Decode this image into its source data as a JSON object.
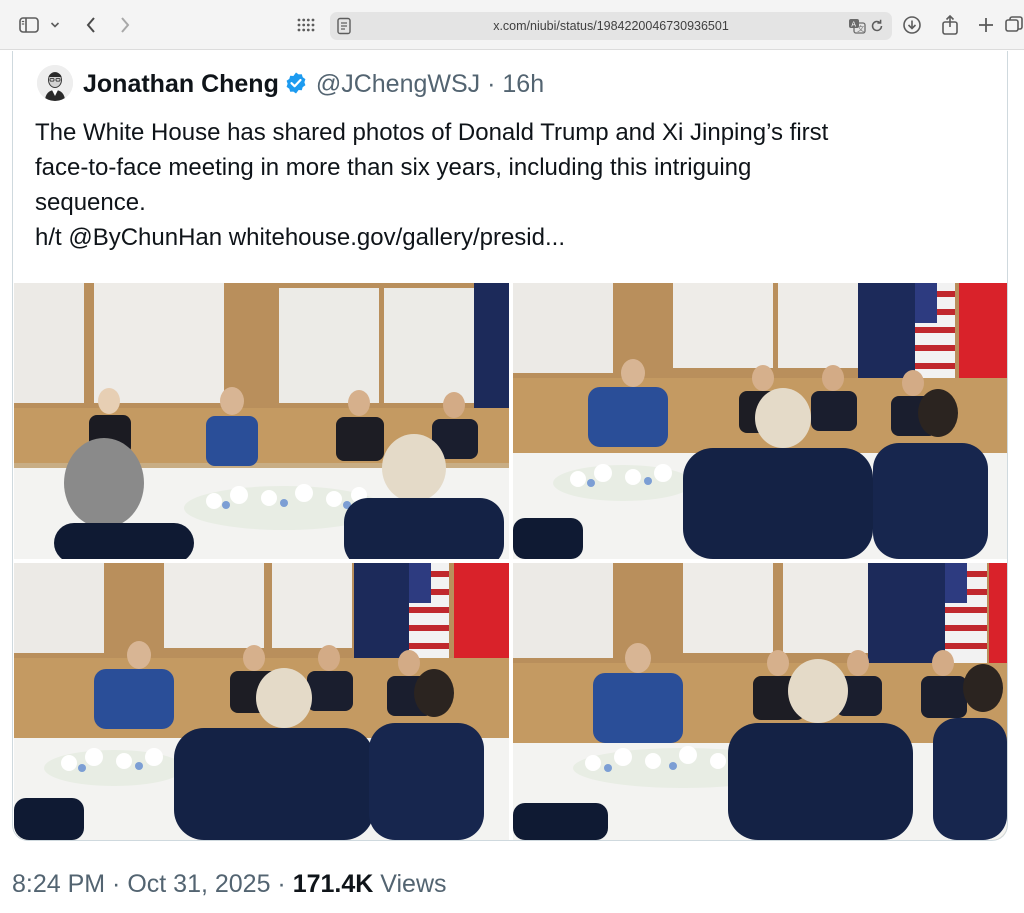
{
  "browser": {
    "url": "x.com/niubi/status/1984220046730936501",
    "icons": [
      "sidebar-icon",
      "chevron-down-icon",
      "back-icon",
      "forward-icon",
      "grid-icon",
      "page-icon",
      "translate-icon",
      "reload-icon",
      "download-icon",
      "share-icon",
      "new-tab-icon",
      "tabs-icon"
    ]
  },
  "tweet": {
    "author_name": "Jonathan Cheng",
    "handle": "@JChengWSJ",
    "separator": " · ",
    "age": "16h",
    "text_lines": [
      "The White House has shared photos of Donald Trump and Xi Jinping’s first",
      "face-to-face meeting in more than six years, including this intriguing",
      "sequence.",
      "h/t @ByChunHan whitehouse.gov/gallery/presid..."
    ],
    "photos_count": 4
  },
  "meta": {
    "time": "8:24 PM",
    "sep1": " · ",
    "date": "Oct 31, 2025",
    "sep2": " · ",
    "views_count": "171.4K",
    "views_label": " Views"
  },
  "colors": {
    "text": "#0f1419",
    "secondary": "#536471",
    "verified": "#1d9bf0",
    "border": "#cfd9de"
  }
}
